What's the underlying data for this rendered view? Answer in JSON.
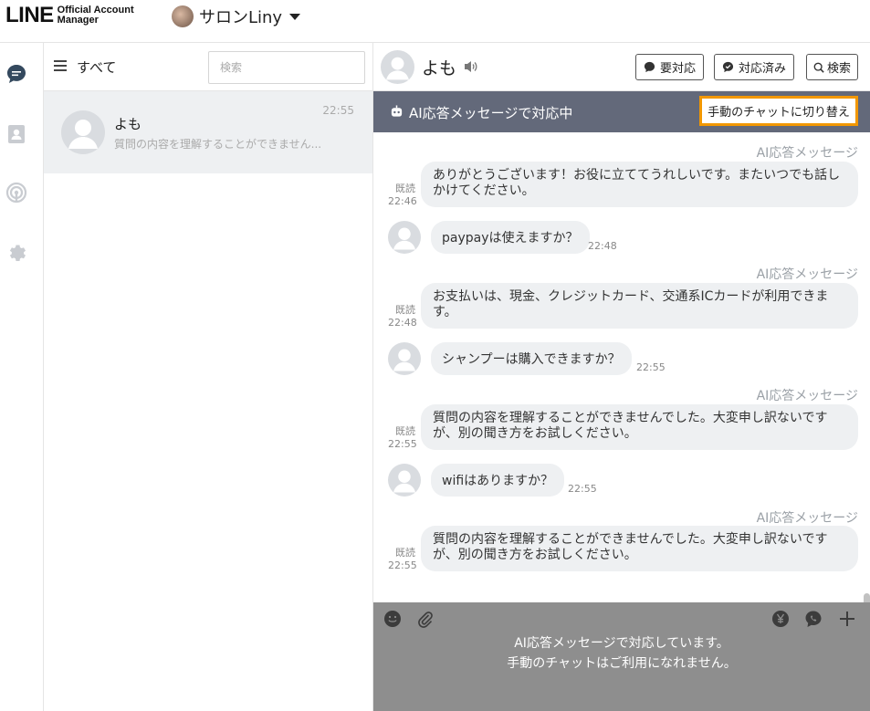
{
  "header": {
    "logo_main": "LINE",
    "logo_sub_1": "Official Account",
    "logo_sub_2": "Manager",
    "account_name": "サロンLiny"
  },
  "chat_list": {
    "filter_label": "すべて",
    "search_placeholder": "検索",
    "conversations": [
      {
        "name": "よも",
        "preview": "質問の内容を理解することができません...",
        "time": "22:55"
      }
    ]
  },
  "chat": {
    "contact_name": "よも",
    "buttons": {
      "needs_action": "要対応",
      "resolved": "対応済み",
      "search": "検索"
    },
    "ai_banner": {
      "label": "AI応答メッセージで対応中",
      "switch_button": "手動のチャットに切り替え"
    },
    "messages": [
      {
        "type": "out",
        "tag": "AI応答メッセージ",
        "read": "既読",
        "time": "22:46",
        "text": "ありがとうございます！お役に立ててうれしいです。またいつでも話しかけてください。"
      },
      {
        "type": "in",
        "text": "paypayは使えますか？",
        "time": "22:48"
      },
      {
        "type": "out",
        "tag": "AI応答メッセージ",
        "read": "既読",
        "time": "22:48",
        "text": "お支払いは、現金、クレジットカード、交通系ICカードが利用できます。"
      },
      {
        "type": "in",
        "text": "シャンプーは購入できますか？",
        "time": "22:55"
      },
      {
        "type": "out",
        "tag": "AI応答メッセージ",
        "read": "既読",
        "time": "22:55",
        "text": "質問の内容を理解することができませんでした。大変申し訳ないですが、別の聞き方をお試しください。"
      },
      {
        "type": "in",
        "text": "wifiはありますか？",
        "time": "22:55"
      },
      {
        "type": "out",
        "tag": "AI応答メッセージ",
        "read": "既読",
        "time": "22:55",
        "text": "質問の内容を理解することができませんでした。大変申し訳ないですが、別の聞き方をお試しください。"
      }
    ],
    "composer_notice_1": "AI応答メッセージで対応しています。",
    "composer_notice_2": "手動のチャットはご利用になれません。"
  },
  "colors": {
    "ai_bar": "#63697a",
    "highlight": "#f29700",
    "bubble": "#eef0f2",
    "composer": "#8e8e8e"
  },
  "icons": [
    "chat-icon",
    "contacts-icon",
    "broadcast-icon",
    "gear-icon",
    "speaker-icon",
    "robot-icon",
    "emoji-icon",
    "paperclip-icon",
    "yen-icon",
    "chat-bubble-icon",
    "plus-icon"
  ]
}
